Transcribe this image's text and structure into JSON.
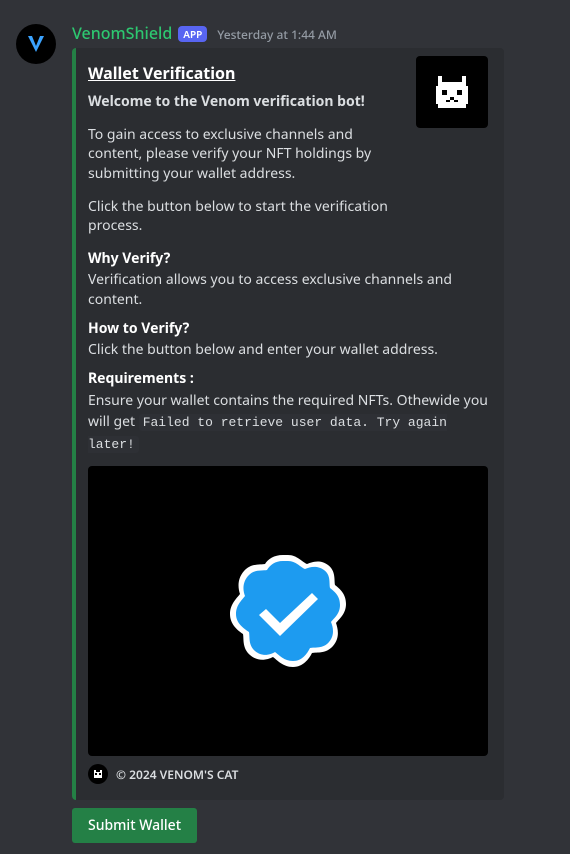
{
  "message": {
    "username": "VenomShield",
    "badge": "APP",
    "timestamp": "Yesterday at 1:44 AM"
  },
  "embed": {
    "title": "Wallet Verification",
    "subtitle": "Welcome to the Venom verification bot!",
    "description1": "To gain access to exclusive channels and content, please verify your NFT holdings by submitting your wallet address.",
    "description2": "Click the button below to start the verification process.",
    "fields": {
      "why_title": "Why Verify?",
      "why_value": "Verification allows you to access exclusive channels and content.",
      "how_title": "How to Verify?",
      "how_value": "Click the button below and enter your wallet address.",
      "req_title": "Requirements :",
      "req_value_pre": "Ensure your wallet contains the required NFTs. Othewide you will get ",
      "req_code": "Failed to retrieve user data. Try again later!"
    },
    "footer": "© 2024 VENOM'S CAT"
  },
  "button": {
    "submit_label": "Submit Wallet"
  }
}
